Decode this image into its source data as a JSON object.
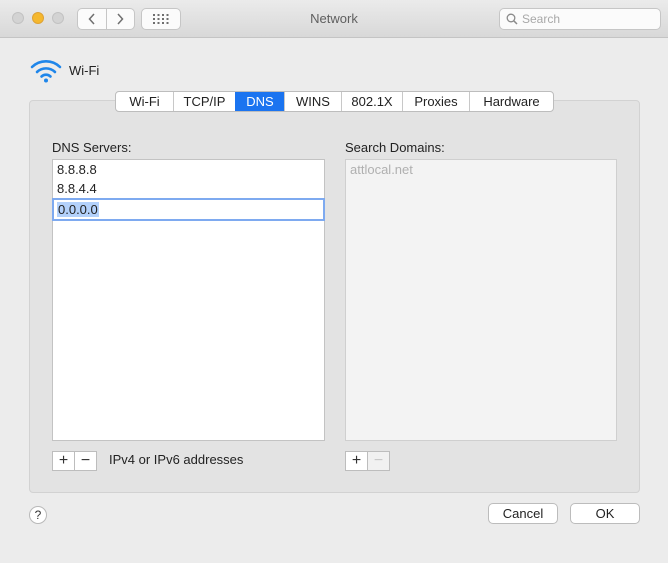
{
  "window": {
    "title": "Network",
    "search_placeholder": "Search"
  },
  "interface": {
    "name": "Wi-Fi",
    "icon": "wifi-icon"
  },
  "tabs": [
    {
      "label": "Wi-Fi",
      "active": false
    },
    {
      "label": "TCP/IP",
      "active": false
    },
    {
      "label": "DNS",
      "active": true
    },
    {
      "label": "WINS",
      "active": false
    },
    {
      "label": "802.1X",
      "active": false
    },
    {
      "label": "Proxies",
      "active": false
    },
    {
      "label": "Hardware",
      "active": false
    }
  ],
  "dns": {
    "label": "DNS Servers:",
    "servers": [
      "8.8.8.8",
      "8.8.4.4"
    ],
    "editing_value": "0.0.0.0",
    "hint": "IPv4 or IPv6 addresses"
  },
  "search_domains": {
    "label": "Search Domains:",
    "placeholder_entry": "attlocal.net"
  },
  "controls": {
    "add": "+",
    "remove": "−",
    "help": "?",
    "cancel": "Cancel",
    "ok": "OK"
  },
  "colors": {
    "accent": "#1b74f0",
    "minimize": "#f5b82e"
  }
}
